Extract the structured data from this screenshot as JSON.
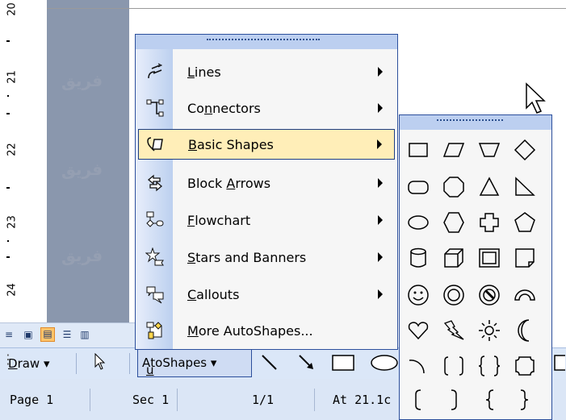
{
  "ruler": {
    "labels": [
      "20",
      "21",
      "22",
      "23",
      "24"
    ]
  },
  "menu": {
    "items": [
      {
        "label": "Lines",
        "underline": "L",
        "icon": "lines-icon",
        "submenu": true
      },
      {
        "label": "Connectors",
        "underline": "n",
        "icon": "connectors-icon",
        "submenu": true
      },
      {
        "label": "Basic Shapes",
        "underline": "B",
        "icon": "basic-shapes-icon",
        "submenu": true,
        "highlighted": true
      },
      {
        "label": "Block Arrows",
        "underline": "A",
        "icon": "block-arrows-icon",
        "submenu": true
      },
      {
        "label": "Flowchart",
        "underline": "F",
        "icon": "flowchart-icon",
        "submenu": true
      },
      {
        "label": "Stars and Banners",
        "underline": "S",
        "icon": "stars-banners-icon",
        "submenu": true
      },
      {
        "label": "Callouts",
        "underline": "C",
        "icon": "callouts-icon",
        "submenu": true
      },
      {
        "label": "More AutoShapes...",
        "underline": "M",
        "icon": "more-autoshapes-icon",
        "submenu": false
      }
    ]
  },
  "submenu": {
    "shapes": [
      "rectangle",
      "parallelogram",
      "trapezoid",
      "diamond",
      "rounded-rectangle",
      "octagon",
      "isosceles-triangle",
      "right-triangle",
      "oval",
      "hexagon",
      "cross",
      "pentagon",
      "can",
      "cube",
      "bevel",
      "folded-corner",
      "smiley-face",
      "donut",
      "no-symbol",
      "block-arc",
      "heart",
      "lightning-bolt",
      "sun",
      "moon",
      "arc",
      "double-bracket",
      "double-brace",
      "plaque",
      "left-bracket",
      "right-bracket",
      "left-brace",
      "right-brace"
    ]
  },
  "toolbar": {
    "draw_label": "Draw",
    "draw_underline": "D",
    "autoshapes_label": "AutoShapes",
    "autoshapes_underline": "u"
  },
  "statusbar": {
    "page": "Page 1",
    "sec": "Sec 1",
    "pages": "1/1",
    "at": "At 21.1c"
  },
  "watermark": {
    "text": "فريق"
  },
  "colors": {
    "menu_border": "#2c4f9c",
    "highlight": "#ffeeb8",
    "toolbar_bg": "#dbe7f8",
    "margin": "#8a97ad"
  }
}
